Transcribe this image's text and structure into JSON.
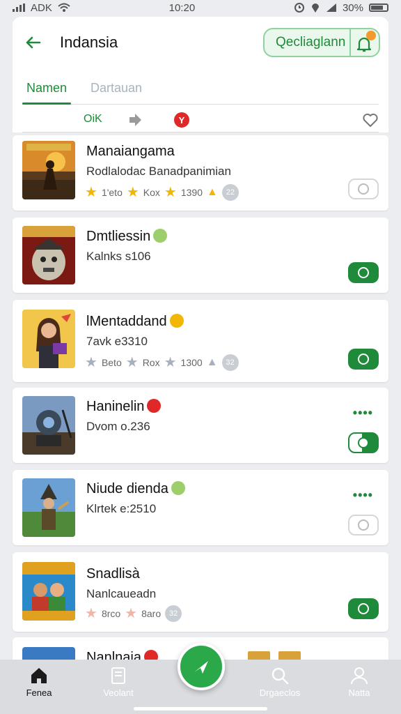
{
  "status_bar": {
    "carrier": "ADK",
    "time": "10:20",
    "battery": "30%"
  },
  "header": {
    "title": "Indansia",
    "download_label": "Qecliaglann",
    "back_icon": "arrow-left-icon",
    "notification_icon": "bell-icon"
  },
  "tabs": [
    {
      "label": "Namen",
      "active": true
    },
    {
      "label": "Dartauan",
      "active": false
    }
  ],
  "filter": {
    "ok_label": "OiK",
    "share_icon": "share-arrow-icon",
    "badge_icon": "red-y-badge-icon",
    "favorite_icon": "heart-icon"
  },
  "items": [
    {
      "title": "Manaiangama",
      "subtitle": "Rodlalodac Banadpanimian",
      "meta": [
        "1'eto",
        "Kox",
        "1390"
      ],
      "count": "22",
      "star_colors": [
        "#f2b705",
        "#f2b705",
        "#f2b705"
      ],
      "action": "outline",
      "badge_color": ""
    },
    {
      "title": "Dmtliessin",
      "subtitle": "Kalnks s106",
      "meta": [],
      "count": "",
      "star_colors": [],
      "action": "filled",
      "badge_color": "#9ccf6b"
    },
    {
      "title": "lMentaddand",
      "subtitle": "7avk e3310",
      "meta": [
        "Beto",
        "Rox",
        "1300"
      ],
      "count": "32",
      "star_colors": [
        "#a7b0bd",
        "#a7b0bd",
        "#a7b0bd"
      ],
      "action": "filled",
      "badge_color": "#f2b705"
    },
    {
      "title": "Haninelin",
      "subtitle": "Dvom o.236",
      "meta": [],
      "count": "",
      "star_colors": [],
      "action": "half",
      "badge_color": "#e02828"
    },
    {
      "title": "Niude dienda",
      "subtitle": "Klrtek e:2510",
      "meta": [],
      "count": "",
      "star_colors": [],
      "action": "outline",
      "badge_color": "#9ccf6b"
    },
    {
      "title": "Snadlisà",
      "subtitle": "Nanlcaueadn",
      "meta": [
        "8rco",
        "8aro"
      ],
      "count": "32",
      "star_colors": [
        "#f3b6a6",
        "#f3b6a6"
      ],
      "action": "filled",
      "badge_color": ""
    },
    {
      "title": "Nanlnaia",
      "subtitle": "",
      "meta": [],
      "count": "",
      "star_colors": [],
      "action": "",
      "badge_color": "#e02828"
    }
  ],
  "bottom_nav": [
    {
      "label": "Fenea",
      "icon": "home-icon",
      "active": true
    },
    {
      "label": "Veolant",
      "icon": "library-icon",
      "active": false
    },
    {
      "label": "Drgaeclos",
      "icon": "search-icon",
      "active": false
    },
    {
      "label": "Natta",
      "icon": "profile-icon",
      "active": false
    }
  ],
  "fab": {
    "icon": "compass-arrow-icon"
  },
  "colors": {
    "accent": "#1e8a3a",
    "accent_light": "#eaf7ec",
    "background": "#ecedf0"
  }
}
